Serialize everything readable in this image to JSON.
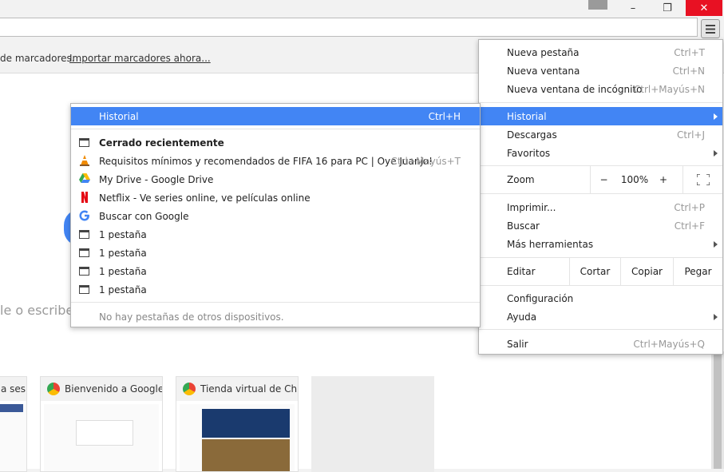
{
  "window": {
    "minimize": "–",
    "maximize": "❐",
    "close": "✕"
  },
  "bookmarks_bar": {
    "text": "de marcadores.",
    "import_link": "Importar marcadores ahora..."
  },
  "new_tab_page": {
    "search_placeholder": "le o escribe u",
    "tiles": [
      {
        "title": "a sesi"
      },
      {
        "title": "Bienvenido a Google"
      },
      {
        "title": "Tienda virtual de Chro"
      }
    ]
  },
  "menu": {
    "items": [
      {
        "label": "Nueva pestaña",
        "shortcut": "Ctrl+T"
      },
      {
        "label": "Nueva ventana",
        "shortcut": "Ctrl+N"
      },
      {
        "label": "Nueva ventana de incógnito",
        "shortcut": "Ctrl+Mayús+N"
      },
      {
        "label": "Historial",
        "shortcut": ""
      },
      {
        "label": "Descargas",
        "shortcut": "Ctrl+J"
      },
      {
        "label": "Favoritos",
        "shortcut": ""
      },
      {
        "label": "Imprimir...",
        "shortcut": "Ctrl+P"
      },
      {
        "label": "Buscar",
        "shortcut": "Ctrl+F"
      },
      {
        "label": "Más herramientas",
        "shortcut": ""
      },
      {
        "label": "Configuración",
        "shortcut": ""
      },
      {
        "label": "Ayuda",
        "shortcut": ""
      },
      {
        "label": "Salir",
        "shortcut": "Ctrl+Mayús+Q"
      }
    ],
    "zoom": {
      "label": "Zoom",
      "minus": "−",
      "value": "100%",
      "plus": "+"
    },
    "edit": {
      "label": "Editar",
      "cut": "Cortar",
      "copy": "Copiar",
      "paste": "Pegar"
    }
  },
  "history_submenu": {
    "header": {
      "label": "Historial",
      "shortcut": "Ctrl+H"
    },
    "recently_closed": "Cerrado recientemente",
    "entries": [
      {
        "label": "Requisitos mínimos y recomendados de FIFA 16 para PC | Oye Juanjo!",
        "shortcut": "Ctrl+Mayús+T",
        "icon": "vlc-cone-icon"
      },
      {
        "label": "My Drive - Google Drive",
        "shortcut": "",
        "icon": "google-drive-icon"
      },
      {
        "label": "Netflix - Ve series online, ve películas online",
        "shortcut": "",
        "icon": "netflix-icon"
      },
      {
        "label": "Buscar con Google",
        "shortcut": "",
        "icon": "google-icon"
      },
      {
        "label": "1 pestaña",
        "shortcut": "",
        "icon": "tab-icon"
      },
      {
        "label": "1 pestaña",
        "shortcut": "",
        "icon": "tab-icon"
      },
      {
        "label": "1 pestaña",
        "shortcut": "",
        "icon": "tab-icon"
      },
      {
        "label": "1 pestaña",
        "shortcut": "",
        "icon": "tab-icon"
      }
    ],
    "footer": "No hay pestañas de otros dispositivos."
  },
  "colors": {
    "accent": "#4285f4",
    "close": "#e81123",
    "netflix": "#e50914"
  }
}
